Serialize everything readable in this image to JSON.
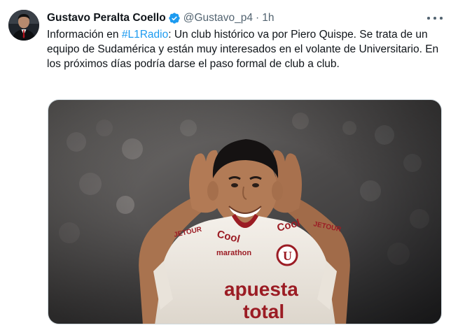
{
  "tweet": {
    "author_name": "Gustavo Peralta Coello",
    "handle": "@Gustavo_p4",
    "separator": "·",
    "time": "1h",
    "verified_icon": "verified-badge-icon",
    "more_icon": "more-options-icon",
    "text_before": "Información en ",
    "hashtag": "#L1Radio",
    "text_after": ": Un club histórico va por Piero Quispe. Se trata de un equipo de Sudamérica y están muy interesados en el volante de Universitario. En los próximos días podría darse el paso formal de club a club."
  },
  "image": {
    "sponsors": {
      "sleeve": "JETOUR",
      "chest_left": "Cool",
      "chest_right": "Cool",
      "sleeve_right": "JETOUR",
      "marathon": "marathon",
      "main_line1": "apuesta",
      "main_line2": "total",
      "crest": "U"
    }
  },
  "colors": {
    "text_primary": "#0f1419",
    "text_secondary": "#536471",
    "accent": "#1d9bf0",
    "jersey": "#f2ede6",
    "jersey_red": "#9b1c24"
  }
}
